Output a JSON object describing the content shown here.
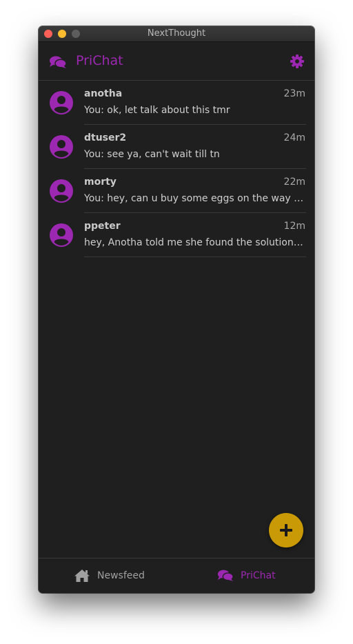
{
  "window": {
    "title": "NextThought"
  },
  "header": {
    "title": "PriChat",
    "app_icon": "chat-bubbles-icon",
    "settings_icon": "gear-icon"
  },
  "colors": {
    "accent": "#9c27b0",
    "fab": "#c99a06",
    "background": "#1f1f1f"
  },
  "conversations": [
    {
      "name": "anotha",
      "time": "23m",
      "preview": "You: ok, let talk about this tmr"
    },
    {
      "name": "dtuser2",
      "time": "24m",
      "preview": "You: see ya, can't wait till tn"
    },
    {
      "name": "morty",
      "time": "22m",
      "preview": "You: hey, can u buy some eggs on the way back home?"
    },
    {
      "name": "ppeter",
      "time": "12m",
      "preview": "hey, Anotha told me she found the solution and sent it over"
    }
  ],
  "fab": {
    "icon": "plus-icon"
  },
  "bottom_nav": {
    "items": [
      {
        "label": "Newsfeed",
        "icon": "home-icon"
      },
      {
        "label": "PriChat",
        "icon": "chat-bubbles-icon"
      }
    ]
  }
}
